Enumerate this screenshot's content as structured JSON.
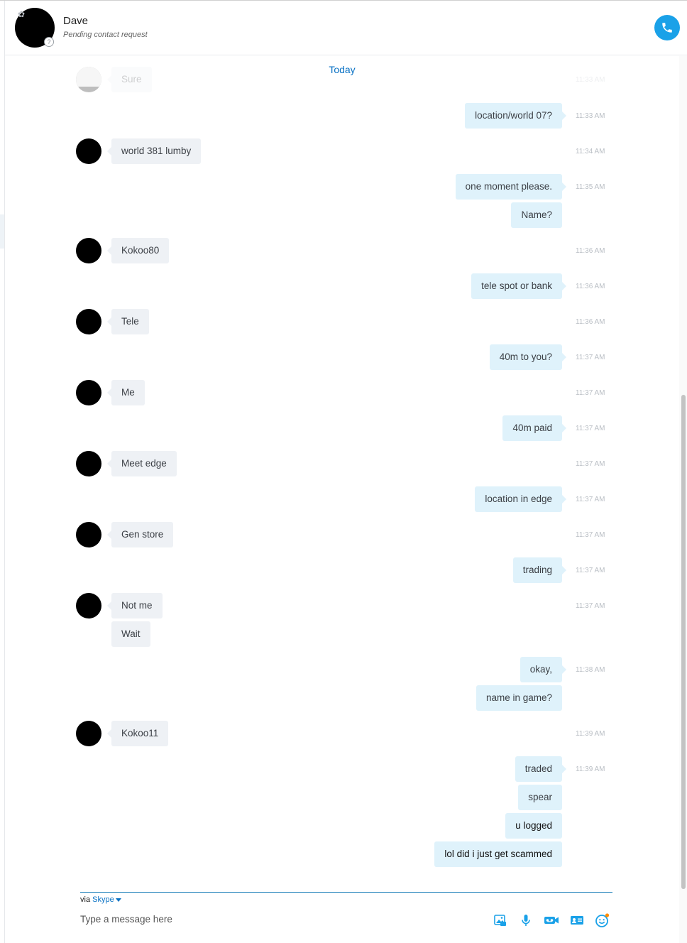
{
  "header": {
    "name": "Dave",
    "status": "Pending contact request",
    "status_icon": "?",
    "favorite_icon": "✿"
  },
  "divider": "Today",
  "messages": [
    {
      "dir": "in",
      "text": "Sure",
      "time": "11:33 AM",
      "avatar": true
    },
    {
      "dir": "out",
      "text": "location/world 07?",
      "time": "11:33 AM"
    },
    {
      "dir": "in",
      "text": "world 381 lumby",
      "time": "11:34 AM",
      "avatar": true
    },
    {
      "dir": "out",
      "text": "one moment please.",
      "time": "11:35 AM"
    },
    {
      "dir": "out",
      "text": "Name?",
      "time": ""
    },
    {
      "dir": "in",
      "text": "Kokoo80",
      "time": "11:36 AM",
      "avatar": true
    },
    {
      "dir": "out",
      "text": "tele spot or bank",
      "time": "11:36 AM"
    },
    {
      "dir": "in",
      "text": "Tele",
      "time": "11:36 AM",
      "avatar": true
    },
    {
      "dir": "out",
      "text": "40m to you?",
      "time": "11:37 AM"
    },
    {
      "dir": "in",
      "text": "Me",
      "time": "11:37 AM",
      "avatar": true
    },
    {
      "dir": "out",
      "text": "40m paid",
      "time": "11:37 AM"
    },
    {
      "dir": "in",
      "text": "Meet edge",
      "time": "11:37 AM",
      "avatar": true
    },
    {
      "dir": "out",
      "text": "location in edge",
      "time": "11:37 AM"
    },
    {
      "dir": "in",
      "text": "Gen store",
      "time": "11:37 AM",
      "avatar": true
    },
    {
      "dir": "out",
      "text": "trading",
      "time": "11:37 AM"
    },
    {
      "dir": "in",
      "text": "Not me",
      "time": "11:37 AM",
      "avatar": true
    },
    {
      "dir": "in",
      "text": "Wait",
      "time": ""
    },
    {
      "dir": "out",
      "text": "okay,",
      "time": "11:38 AM"
    },
    {
      "dir": "out",
      "text": "name in game?",
      "time": ""
    },
    {
      "dir": "in",
      "text": "Kokoo11",
      "time": "11:39 AM",
      "avatar": true
    },
    {
      "dir": "out",
      "text": "traded",
      "time": "11:39 AM"
    },
    {
      "dir": "out",
      "text": "spear",
      "time": ""
    },
    {
      "dir": "out",
      "text": "u logged",
      "time": "",
      "dark": true
    },
    {
      "dir": "out",
      "text": "lol did i just get scammed",
      "time": "",
      "dark": true
    }
  ],
  "composer": {
    "via_prefix": "via",
    "via_service": "Skype",
    "placeholder": "Type a message here",
    "tools": [
      "image-icon",
      "microphone-icon",
      "video-message-icon",
      "contact-card-icon",
      "emoticon-icon"
    ]
  },
  "colors": {
    "accent": "#1aa1e8",
    "link": "#0a72c4",
    "incoming_bubble": "#eef1f5",
    "outgoing_bubble": "#dff2fb",
    "notification_dot": "#ff8c00"
  }
}
